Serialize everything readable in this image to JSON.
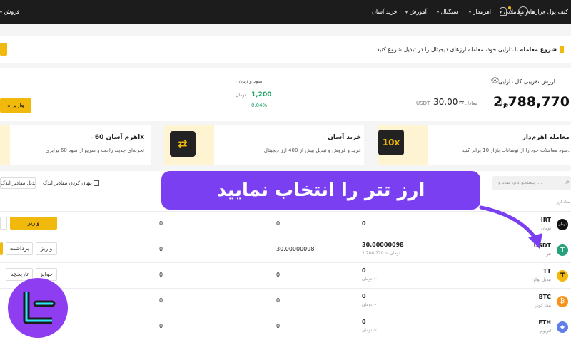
{
  "topbar": {
    "wallet": "کیف پول",
    "easy_buy": "خرید آسان",
    "education": "آموزش",
    "signal": "سیگنال",
    "leverage": "اهرمدار",
    "trading_tools": "ابزارهای معاملاتی",
    "sell": "فروش"
  },
  "banner": {
    "title": "شروع معامله",
    "text": "با دارایی خود، معامله ارزهای دیجیتال را در تبدیل شروع کنید."
  },
  "balance": {
    "label": "ارزش تقریبی کل دارایی",
    "amount": "2,788,770",
    "currency": "تومان",
    "approx_label": "معادل",
    "usdt_value": "30.00",
    "usdt_unit": "USDT",
    "approx_sign": "≈",
    "pnl_label": "سود و زیان",
    "pnl_value": "1,200",
    "pnl_currency": "تومان",
    "pnl_percent": "0.04%",
    "deposit_button": "واریز"
  },
  "promos": [
    {
      "title": "معامله اهرم‌دار",
      "text": "سود معاملات خود را از نوسانات بازار 10 برابر کنید.",
      "badge": "10x"
    },
    {
      "title": "خرید آسان",
      "text": "خرید و فروش و تبدیل بیش از 400 ارز دیجیتال",
      "badge": "⇄"
    },
    {
      "title": "اهرم آسان 60x",
      "text": "تجربه‌ای جدید، راحت و سریع از سود 60 برابری",
      "badge": ""
    }
  ],
  "filters": {
    "search_placeholder": "جستجو نام، نماد و ...",
    "hide_small": "پنهان کردن مقادیر اندک",
    "convert_small": "تبدیل مقادیر اندک",
    "column_symbol": "نماد ارز"
  },
  "overlay": {
    "text": "ارز تتر را انتخاب نمایید"
  },
  "rows": [
    {
      "symbol": "IRT",
      "name": "تومان",
      "balance": "0",
      "balance_sub": "",
      "col2": "0",
      "col3": "0",
      "btn1": "واریز",
      "btn2": "",
      "color": "#111111",
      "icon": "تومان"
    },
    {
      "symbol": "USDT",
      "name": "تتر",
      "balance": "30.00000098",
      "balance_sub": "2,788,770 ~ تومان",
      "col2": "30.00000098",
      "col3": "0",
      "btn1": "واریز",
      "btn2": "برداشت",
      "color": "#26a17b",
      "icon": "T"
    },
    {
      "symbol": "TT",
      "name": "تبدیل توکن",
      "balance": "0",
      "balance_sub": "تومان ~",
      "col2": "0",
      "col3": "0",
      "btn1": "جوایز",
      "btn2": "تاریخچه",
      "color": "#f0b90b",
      "icon": "T"
    },
    {
      "symbol": "BTC",
      "name": "بیت کوین",
      "balance": "0",
      "balance_sub": "تومان ~",
      "col2": "0",
      "col3": "0",
      "btn1": "",
      "btn2": "",
      "color": "#f7931a",
      "icon": "₿"
    },
    {
      "symbol": "ETH",
      "name": "اتریوم",
      "balance": "0",
      "balance_sub": "تومان ~",
      "col2": "0",
      "col3": "0",
      "btn1": "",
      "btn2": "",
      "color": "#627eea",
      "icon": "◆"
    }
  ],
  "colors": {
    "accent": "#f0b90b",
    "overlay": "#7b3ff2",
    "green": "#1aa260"
  }
}
